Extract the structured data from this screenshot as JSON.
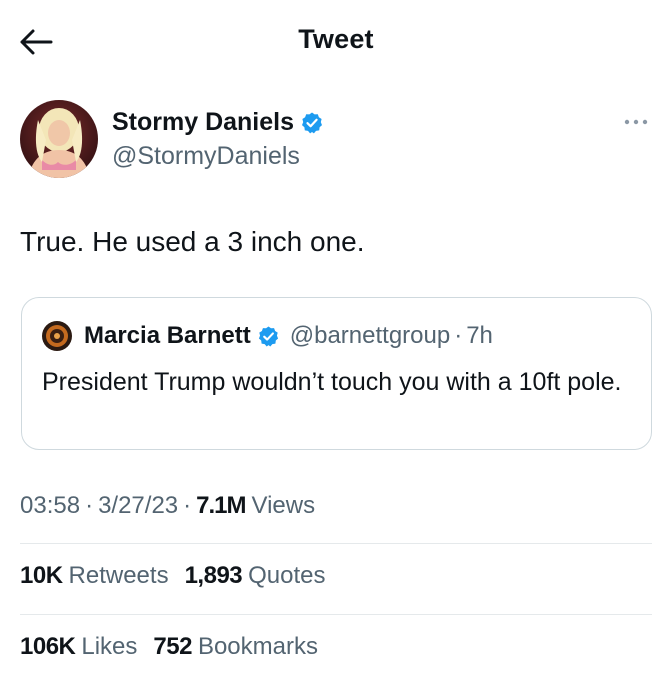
{
  "header": {
    "title": "Tweet",
    "back_icon": "arrow-left-icon"
  },
  "author": {
    "name": "Stormy Daniels",
    "handle": "@StormyDaniels",
    "verified": true,
    "more_icon": "more-horizontal-icon"
  },
  "tweet": {
    "text": "True. He used a 3 inch one."
  },
  "quote": {
    "name": "Marcia Barnett",
    "handle": "@barnettgroup",
    "dot": "·",
    "time": "7h",
    "verified": true,
    "text": "President Trump wouldn’t touch you with a 10ft pole."
  },
  "meta": {
    "time": "03:58",
    "sep1": "·",
    "date": "3/27/23",
    "sep2": "·",
    "views_count": "7.1M",
    "views_label": "Views"
  },
  "stats_row1": {
    "retweets_count": "10K",
    "retweets_label": "Retweets",
    "quotes_count": "1,893",
    "quotes_label": "Quotes"
  },
  "stats_row2": {
    "likes_count": "106K",
    "likes_label": "Likes",
    "bookmarks_count": "752",
    "bookmarks_label": "Bookmarks"
  },
  "colors": {
    "text": "#0f1419",
    "secondary": "#536471",
    "verified_blue": "#1d9bf0",
    "border": "#cfd9de"
  }
}
